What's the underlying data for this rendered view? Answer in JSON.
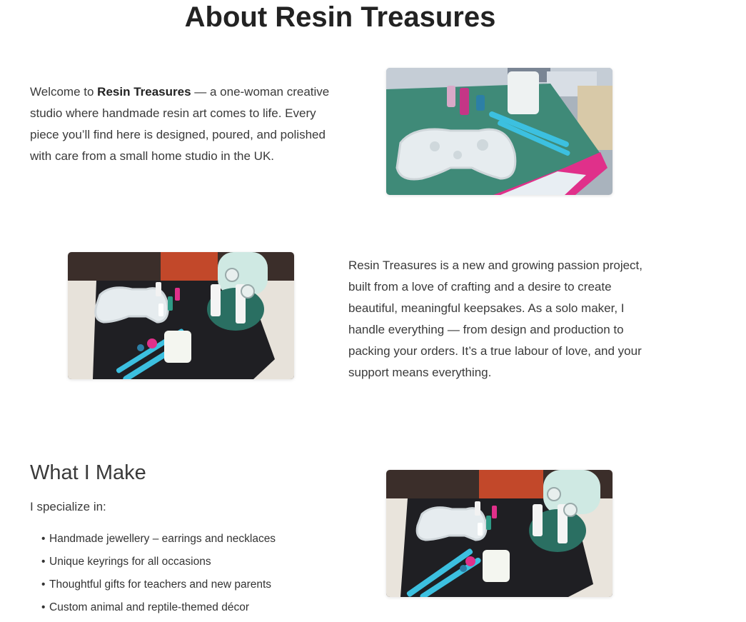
{
  "page": {
    "title": "About Resin Treasures"
  },
  "intro": {
    "prefix": "Welcome to ",
    "brand": "Resin Treasures",
    "suffix": " — a one-woman creative studio where handmade resin art comes to life. Every piece you’ll find here is designed, poured, and polished with care from a small home studio in the UK."
  },
  "story": {
    "text": "Resin Treasures is a new and growing passion project, built from a love of crafting and a desire to create beautiful, meaningful keepsakes. As a solo maker, I handle everything — from design and production to packing your orders. It’s a true labour of love, and your support means everything."
  },
  "what_i_make": {
    "heading": "What I Make",
    "intro": "I specialize in:",
    "items": [
      "Handmade jewellery – earrings and necklaces",
      "Unique keyrings for all occasions",
      "Thoughtful gifts for teachers and new parents",
      "Custom animal and reptile-themed décor"
    ]
  },
  "colors": {
    "cutting_mat": "#3f8a78",
    "dark_mat": "#1f1f23",
    "accent_blue": "#3cc0e0",
    "accent_pink": "#e0308a",
    "mint": "#cfe9e3"
  }
}
